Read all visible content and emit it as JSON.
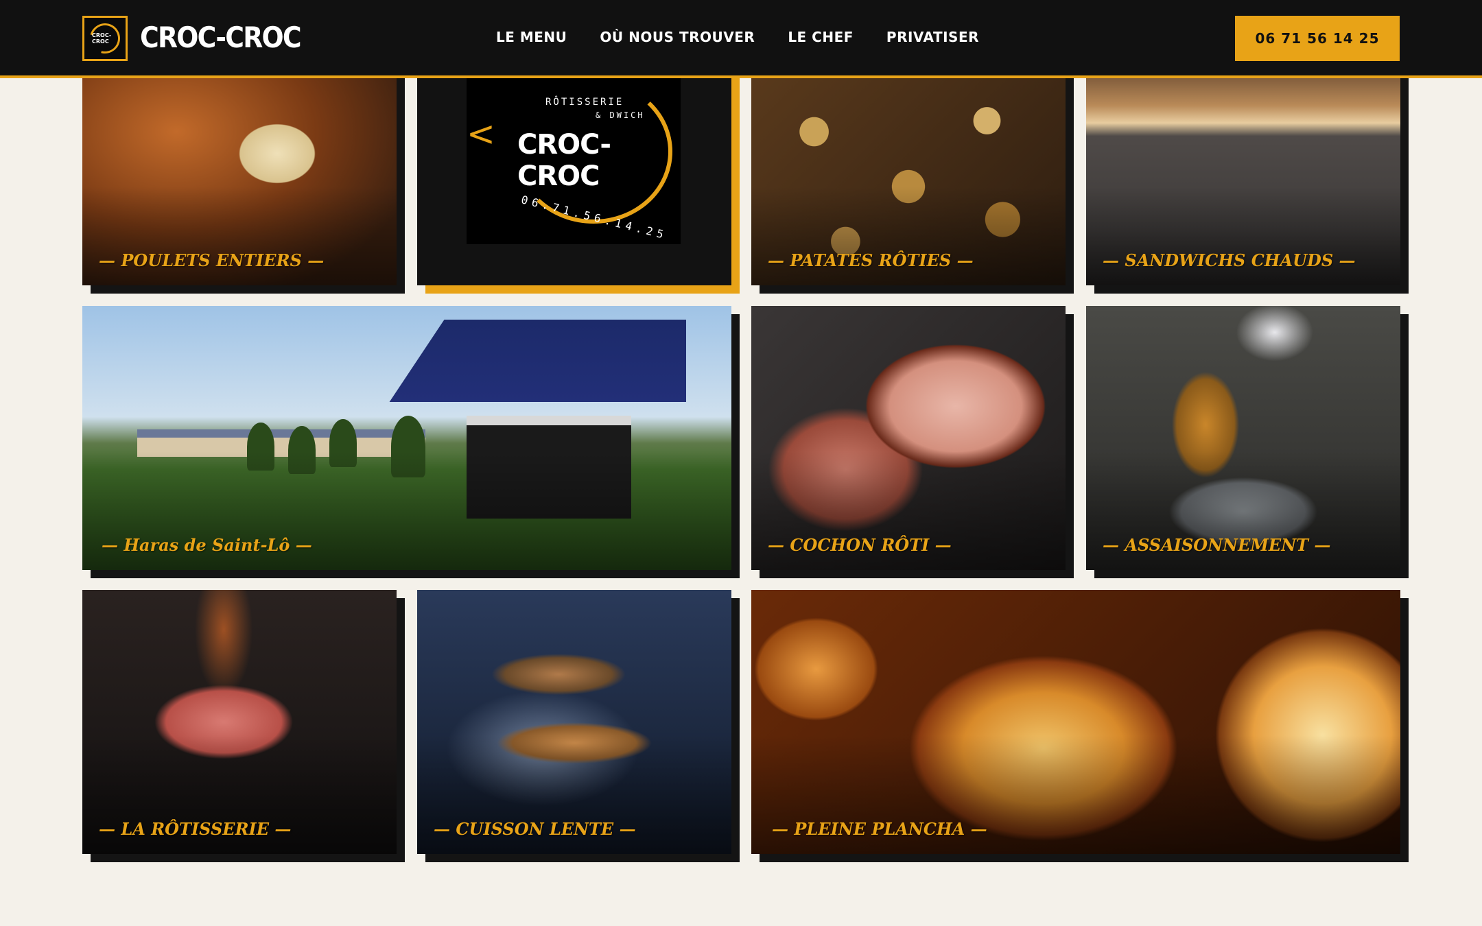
{
  "brand": {
    "name": "CROC-CROC",
    "logo_mini": "CROC-CROC"
  },
  "nav": {
    "items": [
      "LE MENU",
      "OÙ NOUS TROUVER",
      "LE CHEF",
      "PRIVATISER"
    ]
  },
  "phone": "06 71 56 14 25",
  "logo_card": {
    "line1": "RÔTISSERIE",
    "line2": "& DWICH",
    "title": "CROC-CROC",
    "phone": "06.71.56.14.25"
  },
  "gallery": {
    "captions": [
      "— POULETS ENTIERS —",
      "— PATATES RÔTIES —",
      "— SANDWICHS CHAUDS —",
      "— Haras de Saint-Lô —",
      "— COCHON RÔTI —",
      "— ASSAISONNEMENT —",
      "— LA RÔTISSERIE —",
      "— CUISSON LENTE —",
      "— PLEINE PLANCHA —"
    ]
  },
  "colors": {
    "accent": "#e8a317",
    "header_bg": "#111111",
    "page_bg": "#f4f1ea"
  }
}
